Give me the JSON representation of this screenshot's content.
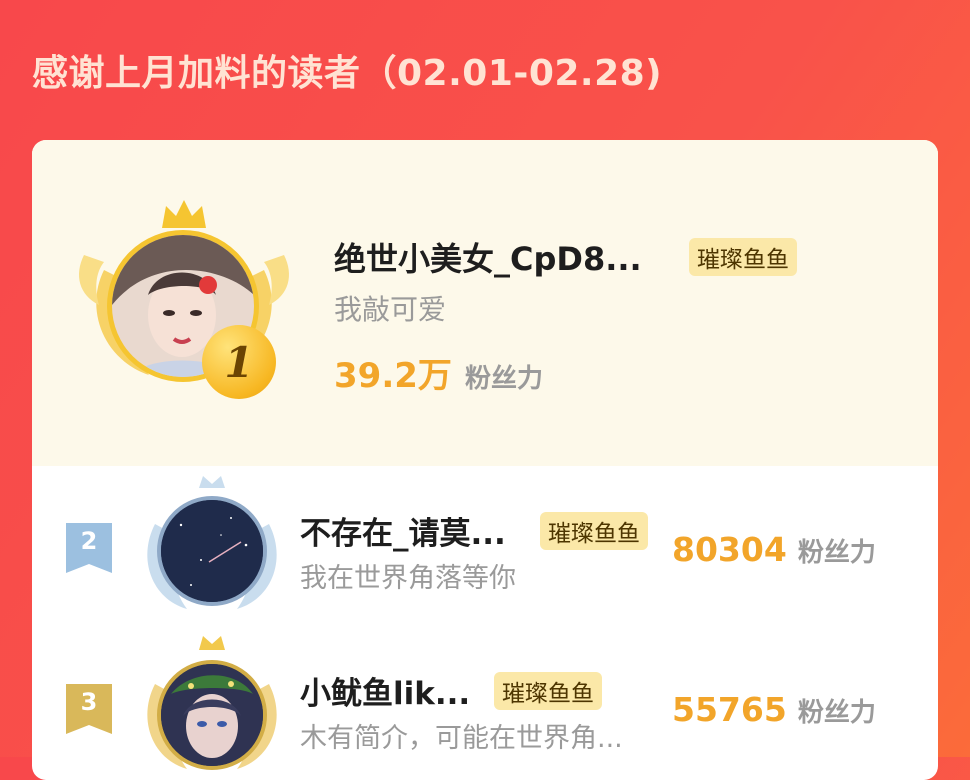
{
  "header": {
    "title": "感谢上月加料的读者（02.01-02.28)"
  },
  "badge_label": "璀璨鱼鱼",
  "readers": [
    {
      "rank": "1",
      "name": "绝世小美女_CpD8...",
      "badge": "璀璨鱼鱼",
      "bio": "我敲可爱",
      "score": "39.2万",
      "score_unit": "粉丝力"
    },
    {
      "rank": "2",
      "name": "不存在_请莫...",
      "badge": "璀璨鱼鱼",
      "bio": "我在世界角落等你",
      "score": "80304",
      "score_unit": "粉丝力"
    },
    {
      "rank": "3",
      "name": "小鱿鱼lik...",
      "badge": "璀璨鱼鱼",
      "bio": "木有简介，可能在世界角...",
      "score": "55765",
      "score_unit": "粉丝力"
    }
  ],
  "colors": {
    "background": "#f8484b",
    "first_place_bg": "#fdf9ea",
    "score": "#f2a52a",
    "badge_bg": "#fbe8a8",
    "rank2_flag": "#9cc0e0",
    "rank3_flag": "#d9b85a"
  }
}
